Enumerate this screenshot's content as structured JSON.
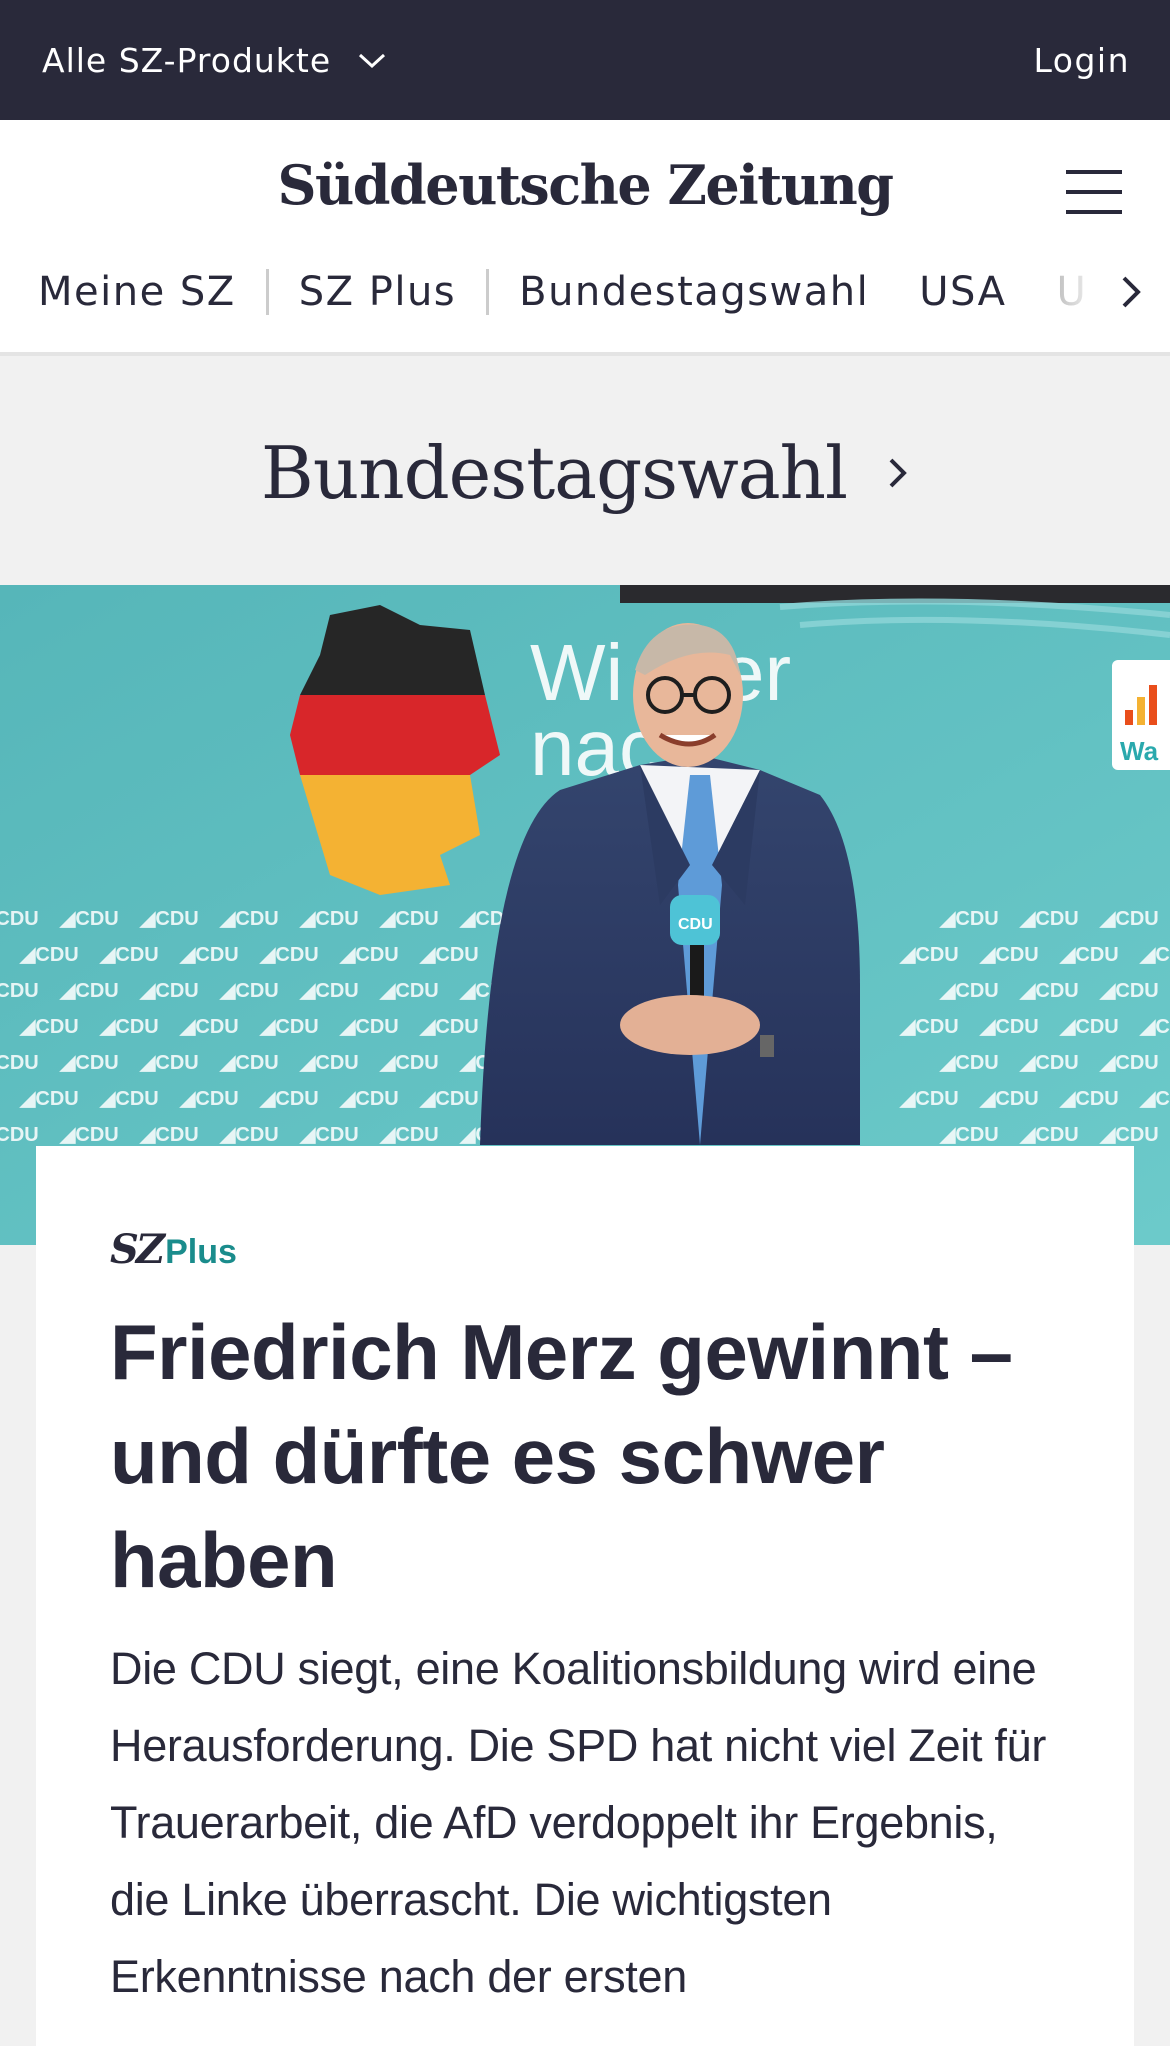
{
  "topbar": {
    "products_label": "Alle SZ-Produkte",
    "login_label": "Login",
    "background": "#29293a"
  },
  "header": {
    "logo_text": "Süddeutsche Zeitung",
    "nav": [
      "Meine SZ",
      "SZ Plus",
      "Bundestagswahl",
      "USA",
      "U"
    ]
  },
  "section": {
    "title": "Bundestagswahl"
  },
  "hero": {
    "backdrop_text_1": "Wi",
    "backdrop_text_2": "er",
    "backdrop_text_3": "nac",
    "backdrop_logo": "CDU",
    "mic_label": "CDU",
    "right_edge_text": "Wa"
  },
  "article": {
    "badge_sz": "SZ",
    "badge_plus": "Plus",
    "headline": "Friedrich Merz gewinnt – und dürfte es schwer haben",
    "teaser": "Die CDU siegt, eine Koalitionsbildung wird eine Herausforderung. Die SPD hat nicht viel Zeit für Trauerarbeit, die AfD verdoppelt ihr Ergebnis, die Linke überrascht. Die wichtigsten Erkenntnisse nach der ersten"
  },
  "colors": {
    "text": "#29293a",
    "accent_plus": "#1a8c8c",
    "page_bg": "#f1f1f1",
    "hero_bg": "#5fbfc2"
  }
}
